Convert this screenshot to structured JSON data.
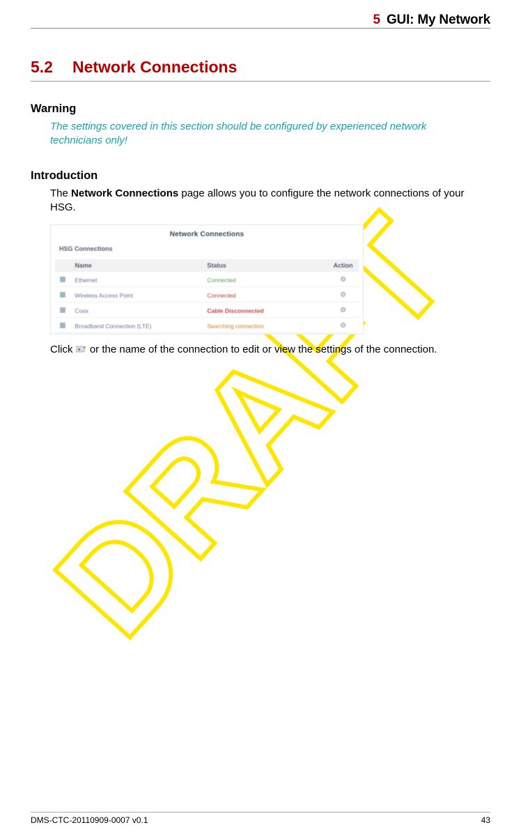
{
  "header": {
    "chapter_num": "5",
    "chapter_title": "GUI: My Network"
  },
  "section": {
    "number": "5.2",
    "title": "Network Connections"
  },
  "warning": {
    "heading": "Warning",
    "text": "The settings covered in this section should be configured by experienced network technicians only!"
  },
  "intro": {
    "heading": "Introduction",
    "before": "The ",
    "bold": "Network Connections",
    "after": " page allows you to configure the network connections of your HSG."
  },
  "ui_panel": {
    "title": "Network Connections",
    "section_label": "HSG Connections",
    "columns": {
      "name": "Name",
      "status": "Status",
      "action": "Action"
    },
    "rows": [
      {
        "name": "Ethernet",
        "status": "Connected",
        "status_class": "sgreen"
      },
      {
        "name": "Wireless Access Point",
        "status": "Connected",
        "status_class": "sgray"
      },
      {
        "name": "Coax",
        "status": "Cable Disconnected",
        "status_class": "sred"
      },
      {
        "name": "Broadband Connection (LTE)",
        "status": "Searching connection",
        "status_class": "sorange"
      }
    ]
  },
  "click_text": {
    "before": "Click ",
    "after": " or the name of the connection to edit or view the settings of the connection."
  },
  "footer": {
    "doc_id": "DMS-CTC-20110909-0007 v0.1",
    "page": "43"
  },
  "watermark": "DRAFT"
}
